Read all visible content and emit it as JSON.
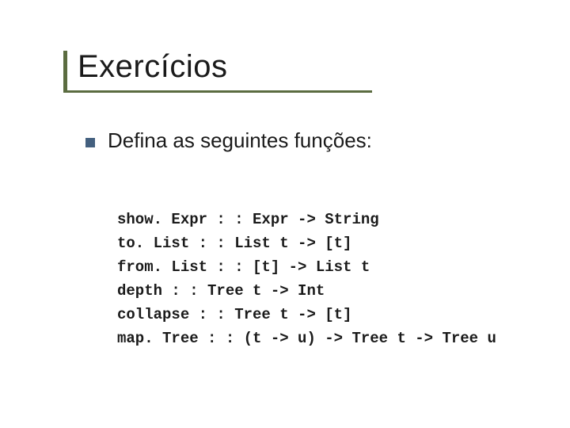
{
  "title": "Exercícios",
  "bullet": "Defina as seguintes funções:",
  "code": {
    "l1": "show. Expr : : Expr -> String",
    "l2": "to. List : : List t -> [t]",
    "l3": "from. List : : [t] -> List t",
    "l4": "depth : : Tree t -> Int",
    "l5": "collapse : : Tree t -> [t]",
    "l6": "map. Tree : : (t -> u) -> Tree t -> Tree u"
  }
}
